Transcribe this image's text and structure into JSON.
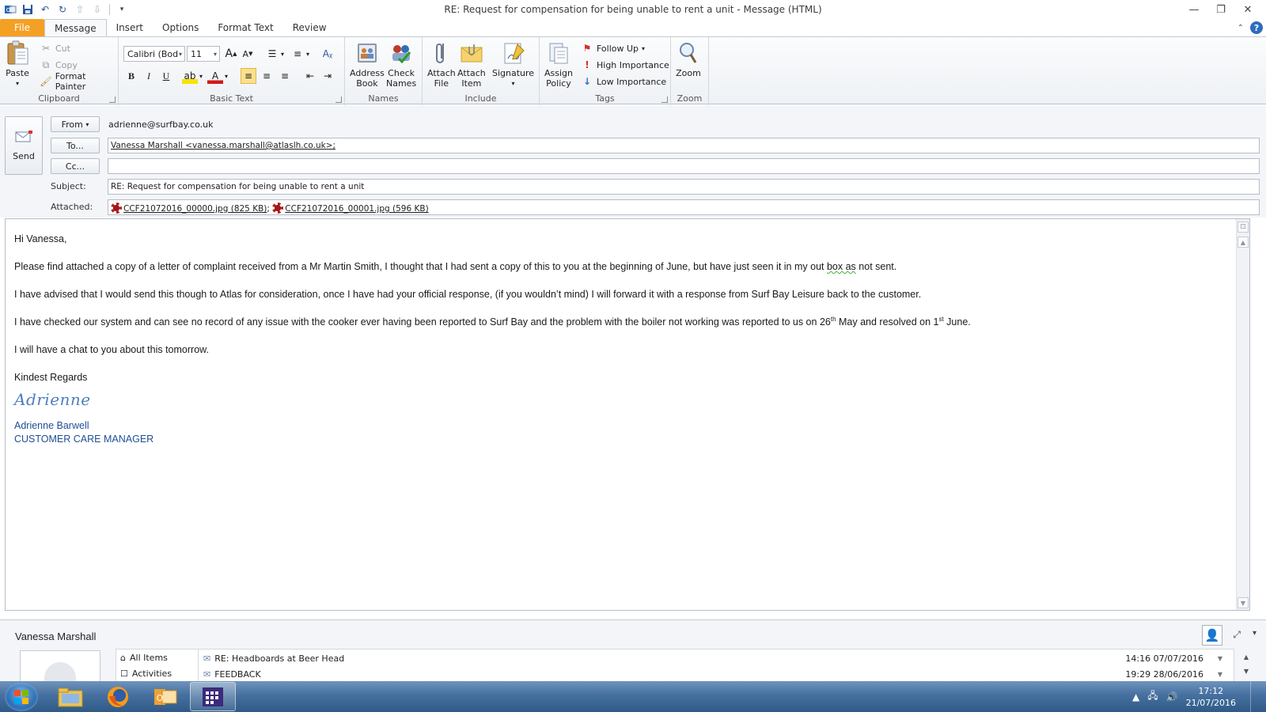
{
  "window": {
    "title": "RE: Request for compensation for being unable to rent a unit  -  Message (HTML)",
    "controls": {
      "minimize": "—",
      "restore": "❐",
      "close": "✕"
    }
  },
  "qat": [
    "save",
    "undo",
    "redo",
    "up",
    "down",
    "customize"
  ],
  "tabs": [
    {
      "label": "File",
      "kind": "file"
    },
    {
      "label": "Message",
      "active": true
    },
    {
      "label": "Insert"
    },
    {
      "label": "Options"
    },
    {
      "label": "Format Text"
    },
    {
      "label": "Review"
    }
  ],
  "ribbon": {
    "clipboard": {
      "label": "Clipboard",
      "paste": "Paste",
      "cut": "Cut",
      "copy": "Copy",
      "format_painter": "Format Painter"
    },
    "basic_text": {
      "label": "Basic Text",
      "font": "Calibri (Bod",
      "size": "11"
    },
    "names": {
      "label": "Names",
      "address_book": "Address\nBook",
      "check_names": "Check\nNames"
    },
    "include": {
      "label": "Include",
      "attach_file": "Attach\nFile",
      "attach_item": "Attach\nItem",
      "signature": "Signature"
    },
    "tags": {
      "label": "Tags",
      "assign_policy": "Assign\nPolicy",
      "follow_up": "Follow Up",
      "high_importance": "High Importance",
      "low_importance": "Low Importance"
    },
    "zoom": {
      "label": "Zoom",
      "zoom": "Zoom"
    }
  },
  "header": {
    "send": "Send",
    "from_label": "From",
    "from_value": "adrienne@surfbay.co.uk",
    "to_label": "To...",
    "to_value": "Vanessa Marshall <vanessa.marshall@atlaslh.co.uk>;",
    "cc_label": "Cc...",
    "cc_value": "",
    "subject_label": "Subject:",
    "subject_value": "RE: Request for compensation for being unable to rent a unit",
    "attached_label": "Attached:",
    "attachments": [
      "CCF21072016_00000.jpg (825 KB)",
      "CCF21072016_00001.jpg (596 KB)"
    ],
    "attach_sep": ";"
  },
  "body": {
    "greeting": "Hi Vanessa,",
    "p1": "Please find attached a copy of a letter of complaint received from a Mr Martin Smith,   I thought that I had sent a copy of this to you at the beginning of June, but have just seen it in my out ",
    "p1_squiggle": "box  as",
    "p1_end": " not sent.",
    "p2": "I have advised that I would send this though to Atlas for consideration, once I have had your official response, (if you wouldn’t mind) I will forward it with a response from Surf Bay Leisure back to the customer.",
    "p3_a": "I have checked our system and can see no record of any issue with the cooker ever having been reported to Surf Bay and the problem with the boiler not working was reported to us on 26",
    "p3_sup1": "th",
    "p3_b": " May and resolved on 1",
    "p3_sup2": "st",
    "p3_c": " June.",
    "p4": "I will have a chat to you about this tomorrow.",
    "closing": "Kindest Regards",
    "signature_script": "Adrienne",
    "sig_name": "Adrienne Barwell",
    "sig_title": "CUSTOMER CARE MANAGER"
  },
  "people_pane": {
    "name": "Vanessa Marshall",
    "tabs": [
      "All Items",
      "Activities"
    ],
    "items": [
      {
        "subject": "RE: Headboards at Beer Head",
        "date": "14:16  07/07/2016"
      },
      {
        "subject": "FEEDBACK",
        "date": "19:29  28/06/2016"
      }
    ]
  },
  "taskbar": {
    "apps": [
      "Windows Explorer",
      "Firefox",
      "Outlook",
      "Calendar app"
    ],
    "time": "17:12",
    "date": "21/07/2016"
  },
  "colors": {
    "file_tab": "#f4a024",
    "accent": "#2b579a",
    "taskbar": "#46709f",
    "signature": "#1f4e95"
  }
}
